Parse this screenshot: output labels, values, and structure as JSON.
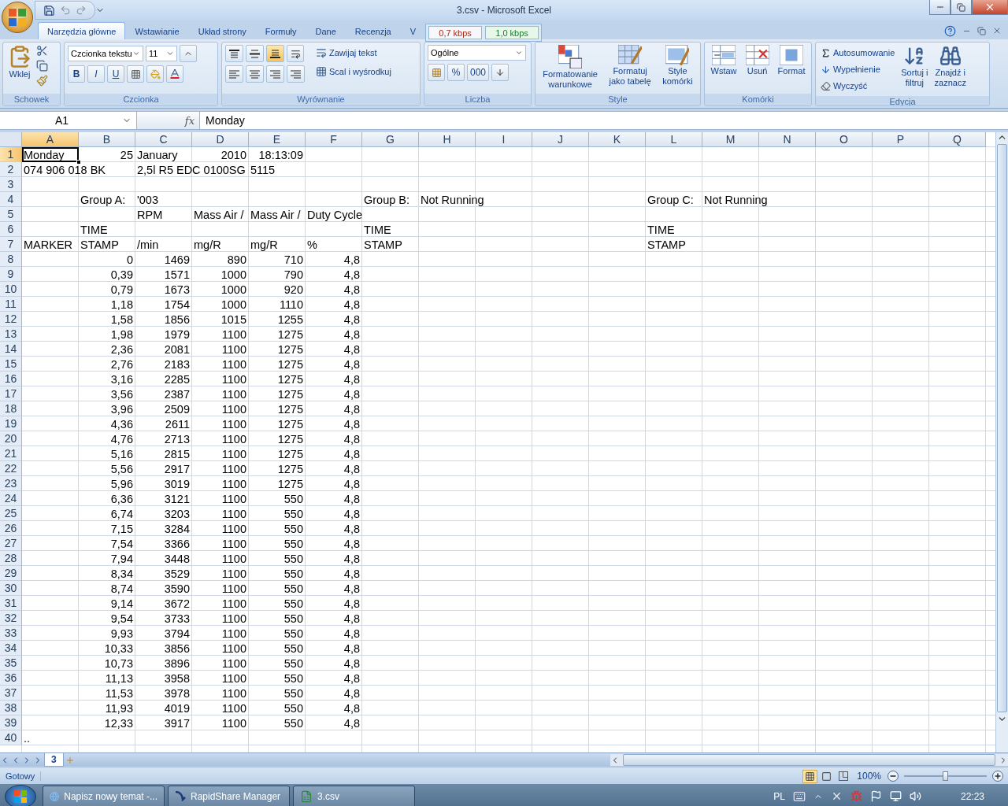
{
  "window": {
    "title": "3.csv - Microsoft Excel"
  },
  "ribbon_tabs": [
    {
      "label": "Narzędzia główne",
      "selected": true
    },
    {
      "label": "Wstawianie",
      "selected": false
    },
    {
      "label": "Układ strony",
      "selected": false
    },
    {
      "label": "Formuły",
      "selected": false
    },
    {
      "label": "Dane",
      "selected": false
    },
    {
      "label": "Recenzja",
      "selected": false
    },
    {
      "label": "V",
      "selected": false
    }
  ],
  "bandwidth_meter": {
    "upload": "0,7 kbps",
    "download": "1,0 kbps"
  },
  "ribbon": {
    "clipboard": {
      "title": "Schowek",
      "paste": "Wklej"
    },
    "font": {
      "title": "Czcionka",
      "font_name": "Czcionka tekstu",
      "font_size": "11",
      "bold": "B",
      "italic": "I",
      "underline": "U"
    },
    "alignment": {
      "title": "Wyrównanie",
      "wrap": "Zawijaj tekst",
      "merge": "Scal i wyśrodkuj"
    },
    "number": {
      "title": "Liczba",
      "format": "Ogólne",
      "percent": "%",
      "thousands": "000"
    },
    "styles": {
      "title": "Style",
      "buttons": [
        {
          "kind": "conditional",
          "lines": [
            "Formatowanie",
            "warunkowe"
          ]
        },
        {
          "kind": "table",
          "lines": [
            "Formatuj",
            "jako tabelę"
          ]
        },
        {
          "kind": "cellstyle",
          "lines": [
            "Style",
            "komórki"
          ]
        }
      ]
    },
    "cells": {
      "title": "Komórki",
      "buttons": [
        {
          "kind": "insert",
          "label": "Wstaw"
        },
        {
          "kind": "delete",
          "label": "Usuń"
        },
        {
          "kind": "format",
          "label": "Format"
        }
      ]
    },
    "editing": {
      "title": "Edycja",
      "autosum": "Autosumowanie",
      "fill": "Wypełnienie",
      "clear": "Wyczyść",
      "sort": [
        "Sortuj i",
        "filtruj"
      ],
      "find": [
        "Znajdź i",
        "zaznacz"
      ]
    }
  },
  "formula_bar": {
    "name_box": "A1",
    "function_label": "fx",
    "value": "Monday"
  },
  "sheet": {
    "columns": [
      {
        "label": "A",
        "selected": true
      },
      {
        "label": "B",
        "selected": false
      },
      {
        "label": "C",
        "selected": false
      },
      {
        "label": "D",
        "selected": false
      },
      {
        "label": "E",
        "selected": false
      },
      {
        "label": "F",
        "selected": false
      },
      {
        "label": "G",
        "selected": false
      },
      {
        "label": "H",
        "selected": false
      },
      {
        "label": "I",
        "selected": false
      },
      {
        "label": "J",
        "selected": false
      },
      {
        "label": "K",
        "selected": false
      },
      {
        "label": "L",
        "selected": false
      },
      {
        "label": "M",
        "selected": false
      },
      {
        "label": "N",
        "selected": false
      },
      {
        "label": "O",
        "selected": false
      },
      {
        "label": "P",
        "selected": false
      },
      {
        "label": "Q",
        "selected": false
      }
    ],
    "rows": [
      {
        "header": "1",
        "selected": true,
        "cells": [
          {
            "text": "Monday",
            "active": true
          },
          {
            "text": "25",
            "right_aligned": true
          },
          "January",
          {
            "text": "2010",
            "right_aligned": true
          },
          {
            "text": "18:13:09",
            "right_aligned": true
          }
        ]
      },
      {
        "header": "2",
        "selected": false,
        "cells": [
          "074 906 018 BK",
          null,
          "2,5l R5 EDC 0100SG",
          null,
          "5115"
        ]
      },
      {
        "header": "3",
        "selected": false,
        "cells": []
      },
      {
        "header": "4",
        "selected": false,
        "cells": [
          null,
          "Group A:",
          "'003",
          null,
          null,
          null,
          "Group B:",
          "Not Running",
          null,
          null,
          null,
          "Group C:",
          "Not Running"
        ]
      },
      {
        "header": "5",
        "selected": false,
        "cells": [
          null,
          null,
          "RPM",
          "Mass Air /",
          "Mass Air /",
          "Duty Cycle"
        ]
      },
      {
        "header": "6",
        "selected": false,
        "cells": [
          null,
          "TIME",
          null,
          null,
          null,
          null,
          "TIME",
          null,
          null,
          null,
          null,
          "TIME"
        ]
      },
      {
        "header": "7",
        "selected": false,
        "cells": [
          "MARKER",
          "STAMP",
          " /min",
          " mg/R",
          " mg/R",
          " %",
          "STAMP",
          null,
          null,
          null,
          null,
          "STAMP"
        ]
      },
      {
        "header": "8",
        "selected": false,
        "right_aligned": true,
        "cells": [
          null,
          "0",
          "1469",
          "890",
          "710",
          "4,8"
        ]
      },
      {
        "header": "9",
        "selected": false,
        "right_aligned": true,
        "cells": [
          null,
          "0,39",
          "1571",
          "1000",
          "790",
          "4,8"
        ]
      },
      {
        "header": "10",
        "selected": false,
        "right_aligned": true,
        "cells": [
          null,
          "0,79",
          "1673",
          "1000",
          "920",
          "4,8"
        ]
      },
      {
        "header": "11",
        "selected": false,
        "right_aligned": true,
        "cells": [
          null,
          "1,18",
          "1754",
          "1000",
          "1110",
          "4,8"
        ]
      },
      {
        "header": "12",
        "selected": false,
        "right_aligned": true,
        "cells": [
          null,
          "1,58",
          "1856",
          "1015",
          "1255",
          "4,8"
        ]
      },
      {
        "header": "13",
        "selected": false,
        "right_aligned": true,
        "cells": [
          null,
          "1,98",
          "1979",
          "1100",
          "1275",
          "4,8"
        ]
      },
      {
        "header": "14",
        "selected": false,
        "right_aligned": true,
        "cells": [
          null,
          "2,36",
          "2081",
          "1100",
          "1275",
          "4,8"
        ]
      },
      {
        "header": "15",
        "selected": false,
        "right_aligned": true,
        "cells": [
          null,
          "2,76",
          "2183",
          "1100",
          "1275",
          "4,8"
        ]
      },
      {
        "header": "16",
        "selected": false,
        "right_aligned": true,
        "cells": [
          null,
          "3,16",
          "2285",
          "1100",
          "1275",
          "4,8"
        ]
      },
      {
        "header": "17",
        "selected": false,
        "right_aligned": true,
        "cells": [
          null,
          "3,56",
          "2387",
          "1100",
          "1275",
          "4,8"
        ]
      },
      {
        "header": "18",
        "selected": false,
        "right_aligned": true,
        "cells": [
          null,
          "3,96",
          "2509",
          "1100",
          "1275",
          "4,8"
        ]
      },
      {
        "header": "19",
        "selected": false,
        "right_aligned": true,
        "cells": [
          null,
          "4,36",
          "2611",
          "1100",
          "1275",
          "4,8"
        ]
      },
      {
        "header": "20",
        "selected": false,
        "right_aligned": true,
        "cells": [
          null,
          "4,76",
          "2713",
          "1100",
          "1275",
          "4,8"
        ]
      },
      {
        "header": "21",
        "selected": false,
        "right_aligned": true,
        "cells": [
          null,
          "5,16",
          "2815",
          "1100",
          "1275",
          "4,8"
        ]
      },
      {
        "header": "22",
        "selected": false,
        "right_aligned": true,
        "cells": [
          null,
          "5,56",
          "2917",
          "1100",
          "1275",
          "4,8"
        ]
      },
      {
        "header": "23",
        "selected": false,
        "right_aligned": true,
        "cells": [
          null,
          "5,96",
          "3019",
          "1100",
          "1275",
          "4,8"
        ]
      },
      {
        "header": "24",
        "selected": false,
        "right_aligned": true,
        "cells": [
          null,
          "6,36",
          "3121",
          "1100",
          "550",
          "4,8"
        ]
      },
      {
        "header": "25",
        "selected": false,
        "right_aligned": true,
        "cells": [
          null,
          "6,74",
          "3203",
          "1100",
          "550",
          "4,8"
        ]
      },
      {
        "header": "26",
        "selected": false,
        "right_aligned": true,
        "cells": [
          null,
          "7,15",
          "3284",
          "1100",
          "550",
          "4,8"
        ]
      },
      {
        "header": "27",
        "selected": false,
        "right_aligned": true,
        "cells": [
          null,
          "7,54",
          "3366",
          "1100",
          "550",
          "4,8"
        ]
      },
      {
        "header": "28",
        "selected": false,
        "right_aligned": true,
        "cells": [
          null,
          "7,94",
          "3448",
          "1100",
          "550",
          "4,8"
        ]
      },
      {
        "header": "29",
        "selected": false,
        "right_aligned": true,
        "cells": [
          null,
          "8,34",
          "3529",
          "1100",
          "550",
          "4,8"
        ]
      },
      {
        "header": "30",
        "selected": false,
        "right_aligned": true,
        "cells": [
          null,
          "8,74",
          "3590",
          "1100",
          "550",
          "4,8"
        ]
      },
      {
        "header": "31",
        "selected": false,
        "right_aligned": true,
        "cells": [
          null,
          "9,14",
          "3672",
          "1100",
          "550",
          "4,8"
        ]
      },
      {
        "header": "32",
        "selected": false,
        "right_aligned": true,
        "cells": [
          null,
          "9,54",
          "3733",
          "1100",
          "550",
          "4,8"
        ]
      },
      {
        "header": "33",
        "selected": false,
        "right_aligned": true,
        "cells": [
          null,
          "9,93",
          "3794",
          "1100",
          "550",
          "4,8"
        ]
      },
      {
        "header": "34",
        "selected": false,
        "right_aligned": true,
        "cells": [
          null,
          "10,33",
          "3856",
          "1100",
          "550",
          "4,8"
        ]
      },
      {
        "header": "35",
        "selected": false,
        "right_aligned": true,
        "cells": [
          null,
          "10,73",
          "3896",
          "1100",
          "550",
          "4,8"
        ]
      },
      {
        "header": "36",
        "selected": false,
        "right_aligned": true,
        "cells": [
          null,
          "11,13",
          "3958",
          "1100",
          "550",
          "4,8"
        ]
      },
      {
        "header": "37",
        "selected": false,
        "right_aligned": true,
        "cells": [
          null,
          "11,53",
          "3978",
          "1100",
          "550",
          "4,8"
        ]
      },
      {
        "header": "38",
        "selected": false,
        "right_aligned": true,
        "cells": [
          null,
          "11,93",
          "4019",
          "1100",
          "550",
          "4,8"
        ]
      },
      {
        "header": "39",
        "selected": false,
        "right_aligned": true,
        "cells": [
          null,
          "12,33",
          "3917",
          "1100",
          "550",
          "4,8"
        ]
      },
      {
        "header": "40",
        "selected": false,
        "cells": [
          ".."
        ]
      }
    ],
    "sheet_tabs": [
      {
        "label": "3",
        "selected": true
      }
    ]
  },
  "status_bar": {
    "status": "Gotowy",
    "views": [
      {
        "kind": "normal",
        "selected": true
      },
      {
        "kind": "page_layout",
        "selected": false
      },
      {
        "kind": "page_break",
        "selected": false
      }
    ],
    "zoom": "100%",
    "zoom_slider": {
      "level": 0.5
    }
  },
  "taskbar": {
    "items": [
      {
        "kind": "browser",
        "label": "Napisz nowy temat -..."
      },
      {
        "kind": "rapidshare",
        "label": "RapidShare Manager"
      },
      {
        "kind": "excel",
        "label": "3.csv"
      }
    ],
    "language": "PL",
    "clock": "22:23"
  }
}
